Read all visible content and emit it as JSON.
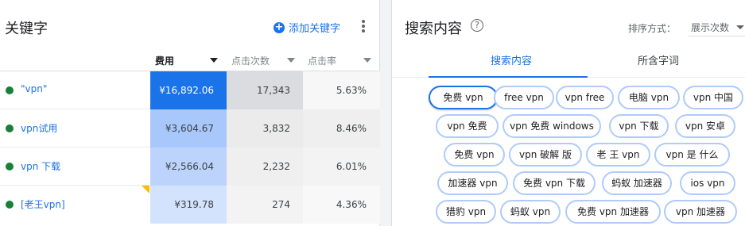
{
  "left": {
    "title": "关键字",
    "add_keyword_label": "添加关键字",
    "columns": {
      "cost": "费用",
      "clicks": "点击次数",
      "ctr": "点击率"
    },
    "rows": [
      {
        "keyword": "\"vpn\"",
        "cost": "¥16,892.06",
        "clicks": "17,343",
        "ctr": "5.63%"
      },
      {
        "keyword": "vpn试用",
        "cost": "¥3,604.67",
        "clicks": "3,832",
        "ctr": "8.46%"
      },
      {
        "keyword": "vpn 下载",
        "cost": "¥2,566.04",
        "clicks": "2,232",
        "ctr": "6.01%"
      },
      {
        "keyword": "[老王vpn]",
        "cost": "¥319.78",
        "clicks": "274",
        "ctr": "4.36%"
      }
    ]
  },
  "right": {
    "title": "搜索内容",
    "sort_label": "排序方式：",
    "sort_value": "展示次数",
    "tabs": [
      "搜索内容",
      "所含字词"
    ],
    "chips": [
      "免费 vpn",
      "free vpn",
      "vpn free",
      "电脑 vpn",
      "vpn 中国",
      "vpn 免费",
      "vpn 免费 windows",
      "vpn 下载",
      "vpn 安卓",
      "免费 vpn",
      "vpn 破解 版",
      "老 王 vpn",
      "vpn 是 什么",
      "加速器 vpn",
      "免费 vpn 下载",
      "蚂蚁 加速器",
      "ios vpn",
      "猎豹 vpn",
      "蚂蚁 vpn",
      "免费 vpn 加速器",
      "vpn 加速器"
    ]
  },
  "colors": {
    "accent": "#1a73e8",
    "status_green": "#188038",
    "chip_border": "#aecbfa",
    "cost_heat": [
      "#1a73e8",
      "#a8c7fa",
      "#bcd4fb",
      "#d3e3fd"
    ],
    "clicks_heat": [
      "#dadce0",
      "#ebebeb",
      "#efefef",
      "#f3f3f3"
    ],
    "ctr_heat": [
      "#f7f7f7",
      "#efefef",
      "#f3f3f3",
      "#f8f8f8"
    ]
  },
  "icons": {
    "add": "plus-circle-icon",
    "more": "more-vert-icon",
    "help": "help-circle-icon",
    "sort": "sort-arrow-icon",
    "status": "status-dot-icon"
  }
}
